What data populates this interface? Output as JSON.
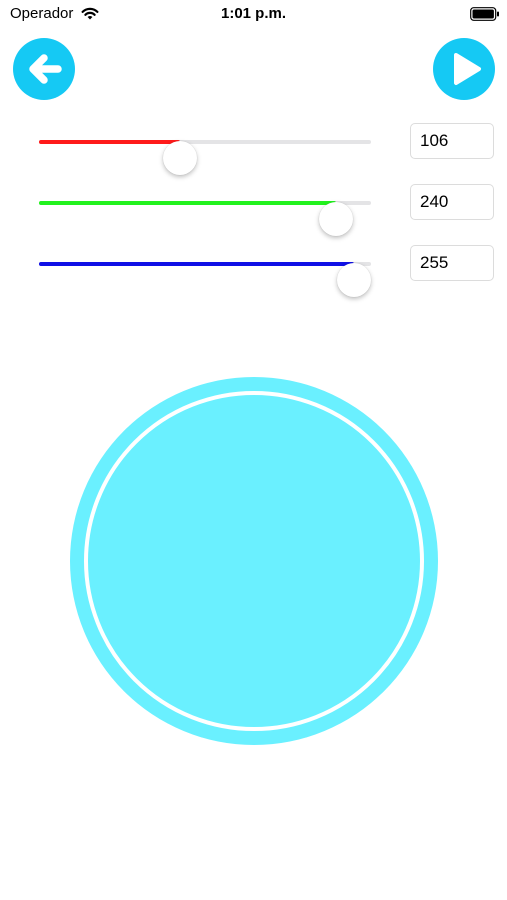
{
  "status_bar": {
    "carrier": "Operador",
    "time": "1:01 p.m.",
    "wifi_icon": "wifi-icon",
    "battery_icon": "battery-icon"
  },
  "nav": {
    "back_icon": "arrow-left-icon",
    "play_icon": "play-icon",
    "button_color": "#15c9f4"
  },
  "sliders": [
    {
      "channel": "red",
      "value": "106",
      "fraction": 0.4157,
      "color": "#ff1a1a"
    },
    {
      "channel": "green",
      "value": "240",
      "fraction": 0.9412,
      "color": "#22f21e"
    },
    {
      "channel": "blue",
      "value": "255",
      "fraction": 1.0,
      "color": "#1010e6"
    }
  ],
  "preview": {
    "color": "#6af0ff",
    "ring_color": "#ffffff"
  }
}
